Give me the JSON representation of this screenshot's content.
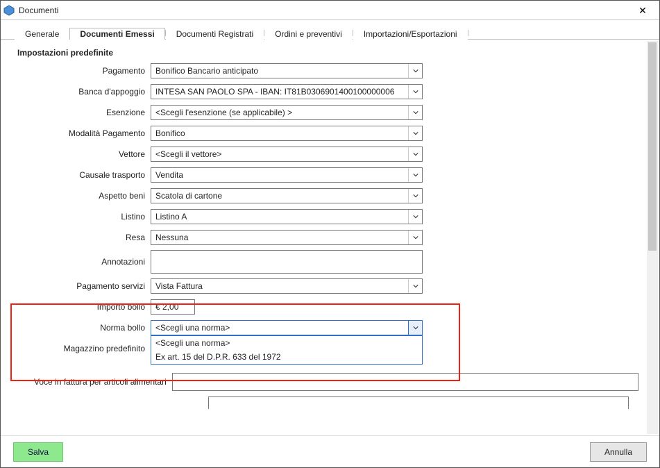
{
  "window": {
    "title": "Documenti"
  },
  "tabs": {
    "generale": "Generale",
    "emessi": "Documenti Emessi",
    "registrati": "Documenti Registrati",
    "ordini": "Ordini e preventivi",
    "impexp": "Importazioni/Esportazioni"
  },
  "groupCaption": "Impostazioni predefinite",
  "labels": {
    "pagamento": "Pagamento",
    "banca": "Banca d'appoggio",
    "esenzione": "Esenzione",
    "modalita": "Modalità Pagamento",
    "vettore": "Vettore",
    "causale": "Causale trasporto",
    "aspetto": "Aspetto beni",
    "listino": "Listino",
    "resa": "Resa",
    "annotazioni": "Annotazioni",
    "pagServizi": "Pagamento servizi",
    "importoBollo": "Importo bollo",
    "normaBollo": "Norma bollo",
    "magazzino": "Magazzino predefinito",
    "voceFattura": "Voce in fattura per articoli alimentari"
  },
  "values": {
    "pagamento": "Bonifico Bancario anticipato",
    "banca": "INTESA SAN PAOLO SPA - IBAN: IT81B0306901400100000006",
    "esenzione": "<Scegli l'esenzione (se applicabile) >",
    "modalita": "Bonifico",
    "vettore": "<Scegli il vettore>",
    "causale": "Vendita",
    "aspetto": "Scatola di cartone",
    "listino": "Listino A",
    "resa": "Nessuna",
    "annotazioni": "",
    "pagServizi": "Vista Fattura",
    "importoBollo": "€ 2,00",
    "normaBollo": "<Scegli una norma>",
    "magazzino": ""
  },
  "normaOptions": [
    "<Scegli una norma>",
    "Ex art. 15 del D.P.R. 633 del 1972"
  ],
  "footer": {
    "save": "Salva",
    "cancel": "Annulla"
  }
}
